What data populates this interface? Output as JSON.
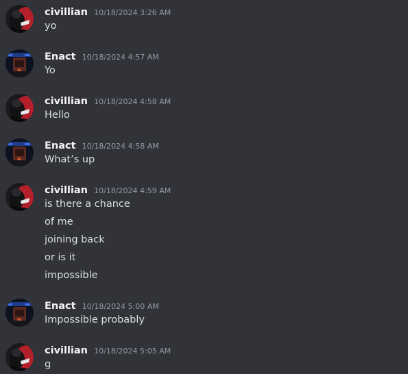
{
  "messages": [
    {
      "author": "civillian",
      "timestamp": "10/18/2024 3:26 AM",
      "lines": [
        "yo"
      ]
    },
    {
      "author": "Enact",
      "timestamp": "10/18/2024 4:57 AM",
      "lines": [
        "Yo"
      ]
    },
    {
      "author": "civillian",
      "timestamp": "10/18/2024 4:58 AM",
      "lines": [
        "Hello"
      ]
    },
    {
      "author": "Enact",
      "timestamp": "10/18/2024 4:58 AM",
      "lines": [
        "What’s up"
      ]
    },
    {
      "author": "civillian",
      "timestamp": "10/18/2024 4:59 AM",
      "lines": [
        "is there a chance",
        "of me",
        "joining back",
        "or is it",
        "impossible"
      ]
    },
    {
      "author": "Enact",
      "timestamp": "10/18/2024 5:00 AM",
      "lines": [
        "Impossible probably"
      ]
    },
    {
      "author": "civillian",
      "timestamp": "10/18/2024 5:05 AM",
      "lines": [
        "g"
      ]
    }
  ]
}
